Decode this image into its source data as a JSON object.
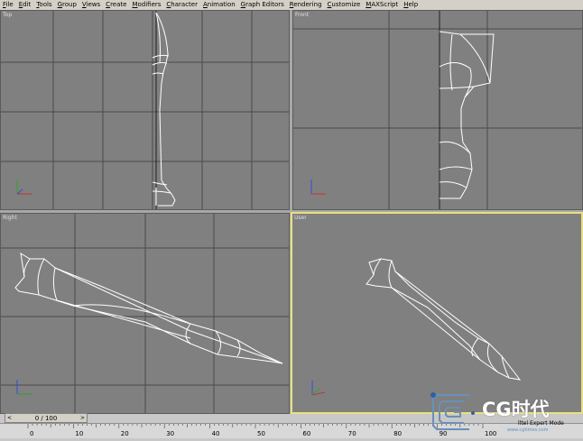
{
  "menu": {
    "items": [
      {
        "label": "File",
        "ul": "F",
        "rest": "ile"
      },
      {
        "label": "Edit",
        "ul": "E",
        "rest": "dit"
      },
      {
        "label": "Tools",
        "ul": "T",
        "rest": "ools"
      },
      {
        "label": "Group",
        "ul": "G",
        "rest": "roup"
      },
      {
        "label": "Views",
        "ul": "V",
        "rest": "iews"
      },
      {
        "label": "Create",
        "ul": "C",
        "rest": "reate"
      },
      {
        "label": "Modifiers",
        "ul": "M",
        "rest": "odifiers"
      },
      {
        "label": "Character",
        "ul": "C",
        "rest": "haracter"
      },
      {
        "label": "Animation",
        "ul": "A",
        "rest": "nimation"
      },
      {
        "label": "Graph Editors",
        "ul": "G",
        "rest": "raph Editors"
      },
      {
        "label": "Rendering",
        "ul": "R",
        "rest": "endering"
      },
      {
        "label": "Customize",
        "ul": "C",
        "rest": "ustomize"
      },
      {
        "label": "MAXScript",
        "ul": "M",
        "rest": "AXScript"
      },
      {
        "label": "Help",
        "ul": "H",
        "rest": "elp"
      }
    ]
  },
  "viewports": {
    "top": {
      "label": "Top"
    },
    "front": {
      "label": "Front"
    },
    "right": {
      "label": "Right"
    },
    "user": {
      "label": "User"
    }
  },
  "timeline": {
    "slider_text": "0 / 100",
    "ticks": [
      "0",
      "10",
      "20",
      "30",
      "40",
      "50",
      "60",
      "70",
      "80",
      "90",
      "100"
    ]
  },
  "watermark": {
    "brand": "CG时代",
    "sub": "lltel Expert Mode",
    "url": "www.cgtimes.com"
  },
  "colors": {
    "viewport_bg": "#808080",
    "grid": "#4a4a4a",
    "wire": "#ffffff",
    "active_border": "#e8e080"
  }
}
